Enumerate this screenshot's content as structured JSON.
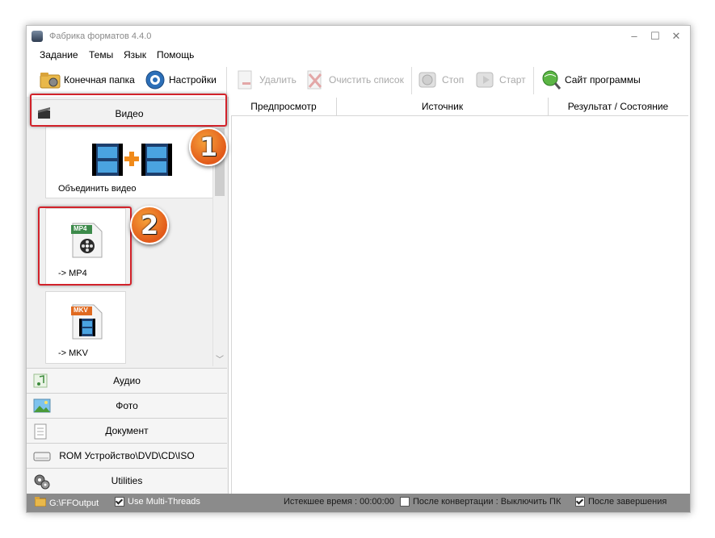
{
  "window": {
    "title": "Фабрика форматов 4.4.0",
    "min": "–",
    "max": "☐",
    "close": "✕"
  },
  "menu": [
    "Задание",
    "Темы",
    "Язык",
    "Помощь"
  ],
  "toolbar": {
    "output_folder": "Конечная папка",
    "settings": "Настройки",
    "delete": "Удалить",
    "clear_list": "Очистить список",
    "stop": "Стоп",
    "start": "Старт",
    "website": "Сайт программы"
  },
  "sidebar": {
    "video": "Видео",
    "video_items": [
      {
        "label": "Объединить видео",
        "icon": "merge-video-icon"
      },
      {
        "label": "-> MP4",
        "badge": "MP4",
        "icon": "mp4-file-icon"
      },
      {
        "label": "-> MKV",
        "badge": "MKV",
        "icon": "mkv-file-icon"
      }
    ],
    "audio": "Аудио",
    "photo": "Фото",
    "document": "Документ",
    "rom": "ROM Устройство\\DVD\\CD\\ISO",
    "utilities": "Utilities"
  },
  "table": {
    "columns": [
      "Предпросмотр",
      "Источник",
      "Результат / Состояние"
    ]
  },
  "status": {
    "output_path": "G:\\FFOutput",
    "multithreads": "Use Multi-Threads",
    "elapsed": "Истекшее время : 00:00:00",
    "after_convert": "После конвертации : Выключить ПК",
    "after_finish": "После завершения"
  },
  "annotations": [
    "1",
    "2"
  ],
  "colors": {
    "callout": "#d2222a",
    "badge": "#e8641e",
    "statusbar": "#8b8b8b"
  }
}
